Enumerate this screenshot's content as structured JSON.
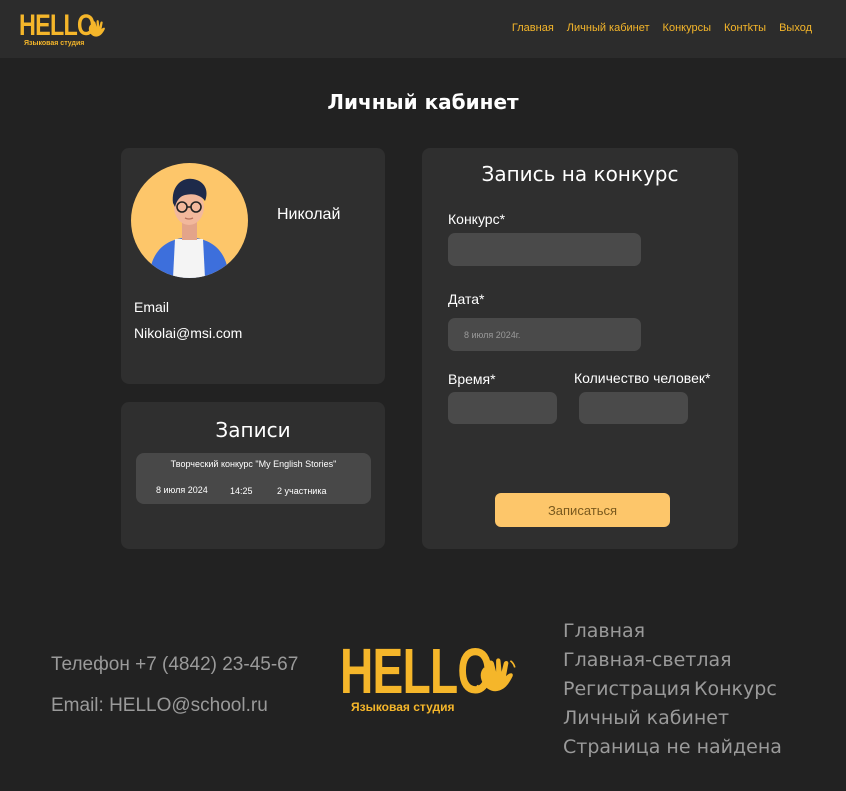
{
  "brand": {
    "logo_text": "HELLO",
    "logo_subtitle": "Языковая студия",
    "accent": "#f5b62a",
    "button_color": "#fdc66a"
  },
  "nav": {
    "items": [
      {
        "label": "Главная"
      },
      {
        "label": "Личный кабинет"
      },
      {
        "label": "Конкурсы"
      },
      {
        "label": "Контkты"
      },
      {
        "label": "Выход"
      }
    ]
  },
  "page": {
    "title": "Личный кабинет"
  },
  "profile": {
    "name": "Николай",
    "email_label": "Email",
    "email_value": "Nikolai@msi.com",
    "avatar_icon": "user-avatar-icon"
  },
  "records": {
    "title": "Записи",
    "items": [
      {
        "name": "Творческий конкурс \"My English Stories\"",
        "date": "8 июля 2024",
        "time": "14:25",
        "participants": "2 участника"
      }
    ]
  },
  "form": {
    "title": "Запись на конкурс",
    "contest_label": "Конкурс*",
    "contest_value": "",
    "date_label": "Дата*",
    "date_placeholder": "8 июля 2024г.",
    "time_label": "Время*",
    "time_value": "",
    "people_label": "Количество человек*",
    "people_value": "",
    "submit_label": "Записаться"
  },
  "footer": {
    "phone": "Телефон +7 (4842) 23-45-67",
    "email": "Email: HELLO@school.ru",
    "links": [
      {
        "label": "Главная"
      },
      {
        "label": "Главная-светлая"
      },
      {
        "label": "Регистрация"
      },
      {
        "label": "Конкурс"
      },
      {
        "label": "Личный кабинет"
      },
      {
        "label": "Страница не найдена"
      }
    ]
  }
}
